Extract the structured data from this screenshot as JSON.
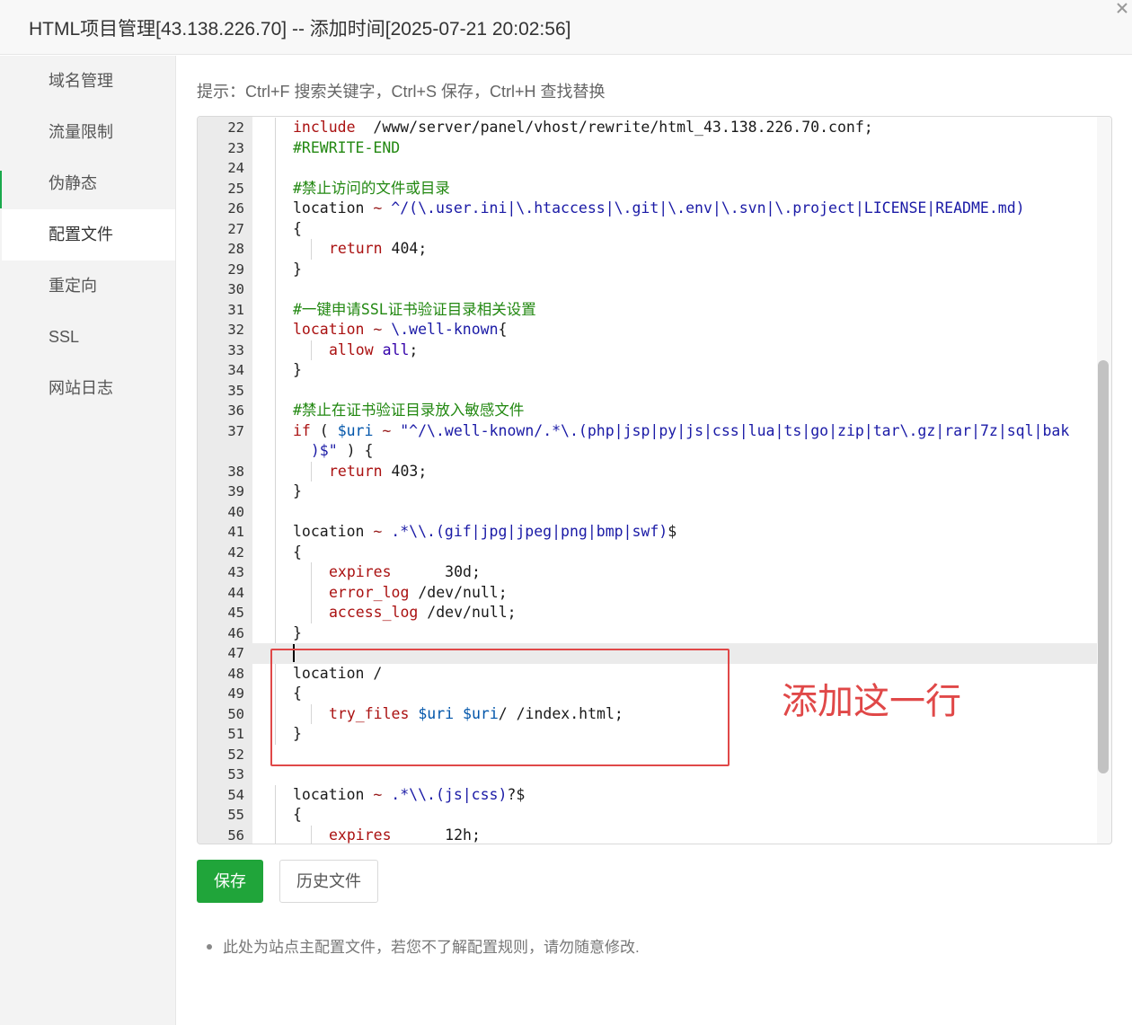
{
  "window": {
    "title": "HTML项目管理[43.138.226.70] -- 添加时间[2025-07-21 20:02:56]"
  },
  "sidebar": {
    "items": [
      {
        "label": "域名管理"
      },
      {
        "label": "流量限制"
      },
      {
        "label": "伪静态"
      },
      {
        "label": "配置文件",
        "active": true
      },
      {
        "label": "重定向"
      },
      {
        "label": "SSL"
      },
      {
        "label": "网站日志"
      }
    ]
  },
  "hint": "提示：Ctrl+F 搜索关键字，Ctrl+S 保存，Ctrl+H 查找替换",
  "editor": {
    "current_line": 47,
    "lines": [
      {
        "n": "22",
        "indent": 1,
        "t": [
          [
            "kw",
            "include"
          ],
          [
            "",
            "  /www/server/panel/vhost/rewrite/html_43.138.226.70.conf;"
          ]
        ]
      },
      {
        "n": "23",
        "indent": 1,
        "t": [
          [
            "cm",
            "#REWRITE-END"
          ]
        ]
      },
      {
        "n": "24",
        "indent": 1,
        "t": []
      },
      {
        "n": "25",
        "indent": 1,
        "t": [
          [
            "cm",
            "#禁止访问的文件或目录"
          ]
        ]
      },
      {
        "n": "26",
        "indent": 1,
        "t": [
          [
            "",
            "location "
          ],
          [
            "op",
            "~"
          ],
          [
            "str",
            " ^/(\\.user.ini|\\.htaccess|\\.git|\\.env|\\.svn|\\.project|LICENSE|README.md)"
          ]
        ]
      },
      {
        "n": "27",
        "indent": 1,
        "t": [
          [
            "",
            "{"
          ]
        ]
      },
      {
        "n": "28",
        "indent": 2,
        "t": [
          [
            "kw",
            "return"
          ],
          [
            "",
            " 404;"
          ]
        ]
      },
      {
        "n": "29",
        "indent": 1,
        "t": [
          [
            "",
            "}"
          ]
        ]
      },
      {
        "n": "30",
        "indent": 1,
        "t": []
      },
      {
        "n": "31",
        "indent": 1,
        "t": [
          [
            "cm",
            "#一键申请SSL证书验证目录相关设置"
          ]
        ]
      },
      {
        "n": "32",
        "indent": 1,
        "t": [
          [
            "kw",
            "location"
          ],
          [
            "op",
            " ~"
          ],
          [
            "str",
            " \\.well-known"
          ],
          [
            "",
            "{"
          ]
        ]
      },
      {
        "n": "33",
        "indent": 2,
        "t": [
          [
            "kw",
            "allow"
          ],
          [
            "val",
            " all"
          ],
          [
            "",
            ";"
          ]
        ]
      },
      {
        "n": "34",
        "indent": 1,
        "t": [
          [
            "",
            "}"
          ]
        ]
      },
      {
        "n": "35",
        "indent": 1,
        "t": []
      },
      {
        "n": "36",
        "indent": 1,
        "t": [
          [
            "cm",
            "#禁止在证书验证目录放入敏感文件"
          ]
        ]
      },
      {
        "n": "37",
        "indent": 1,
        "t": [
          [
            "kw",
            "if"
          ],
          [
            "",
            " ( "
          ],
          [
            "var",
            "$uri"
          ],
          [
            "op",
            " ~"
          ],
          [
            "str",
            " \"^/\\.well-known/.*\\.(php|jsp|py|js|css|lua|ts|go|zip|tar\\.gz|rar|7z|sql|bak"
          ]
        ]
      },
      {
        "n": "",
        "indent": 1,
        "t": [
          [
            "str",
            "  )$\""
          ],
          [
            "",
            " ) {"
          ]
        ]
      },
      {
        "n": "38",
        "indent": 2,
        "t": [
          [
            "kw",
            "return"
          ],
          [
            "",
            " 403;"
          ]
        ]
      },
      {
        "n": "39",
        "indent": 1,
        "t": [
          [
            "",
            "}"
          ]
        ]
      },
      {
        "n": "40",
        "indent": 1,
        "t": []
      },
      {
        "n": "41",
        "indent": 1,
        "t": [
          [
            "",
            "location "
          ],
          [
            "op",
            "~"
          ],
          [
            "str",
            " .*\\\\.(gif|jpg|jpeg|png|bmp|swf)"
          ],
          [
            "",
            "$"
          ]
        ]
      },
      {
        "n": "42",
        "indent": 1,
        "t": [
          [
            "",
            "{"
          ]
        ]
      },
      {
        "n": "43",
        "indent": 2,
        "t": [
          [
            "kw",
            "expires"
          ],
          [
            "",
            "      30d;"
          ]
        ]
      },
      {
        "n": "44",
        "indent": 2,
        "t": [
          [
            "kw",
            "error_log"
          ],
          [
            "",
            " /dev/null;"
          ]
        ]
      },
      {
        "n": "45",
        "indent": 2,
        "t": [
          [
            "kw",
            "access_log"
          ],
          [
            "",
            " /dev/null;"
          ]
        ]
      },
      {
        "n": "46",
        "indent": 1,
        "t": [
          [
            "",
            "}"
          ]
        ]
      },
      {
        "n": "47",
        "indent": 0,
        "t": []
      },
      {
        "n": "48",
        "indent": 1,
        "t": [
          [
            "",
            "location /"
          ]
        ]
      },
      {
        "n": "49",
        "indent": 1,
        "t": [
          [
            "",
            "{"
          ]
        ]
      },
      {
        "n": "50",
        "indent": 2,
        "t": [
          [
            "kw",
            "try_files"
          ],
          [
            "var",
            " $uri"
          ],
          [
            "var",
            " $uri"
          ],
          [
            "",
            "/ /index.html;"
          ]
        ]
      },
      {
        "n": "51",
        "indent": 1,
        "t": [
          [
            "",
            "}"
          ]
        ]
      },
      {
        "n": "52",
        "indent": 0,
        "t": []
      },
      {
        "n": "53",
        "indent": 0,
        "t": []
      },
      {
        "n": "54",
        "indent": 1,
        "t": [
          [
            "",
            "location "
          ],
          [
            "op",
            "~"
          ],
          [
            "str",
            " .*\\\\.(js|css)"
          ],
          [
            "",
            "?$"
          ]
        ]
      },
      {
        "n": "55",
        "indent": 1,
        "t": [
          [
            "",
            "{"
          ]
        ]
      },
      {
        "n": "56",
        "indent": 2,
        "t": [
          [
            "kw",
            "expires"
          ],
          [
            "",
            "      12h;"
          ]
        ]
      }
    ]
  },
  "annotation": {
    "text": "添加这一行",
    "color": "#e04848"
  },
  "buttons": {
    "save": "保存",
    "history": "历史文件"
  },
  "note": "此处为站点主配置文件，若您不了解配置规则，请勿随意修改."
}
